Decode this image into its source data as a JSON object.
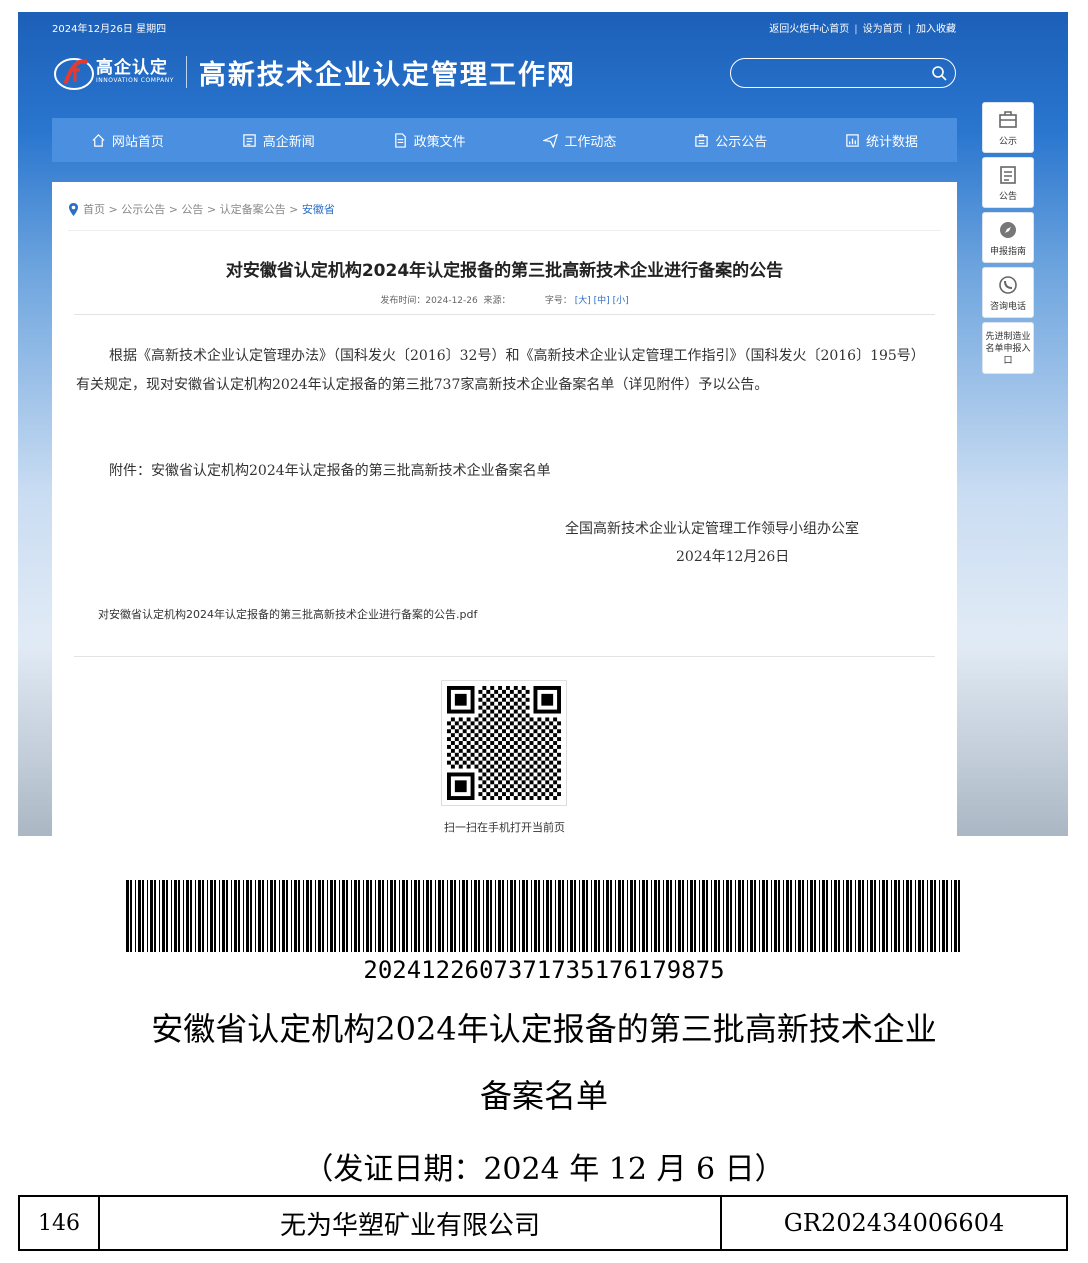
{
  "topbar": {
    "date": "2024年12月26日 星期四",
    "links": [
      "返回火炬中心首页",
      "设为首页",
      "加入收藏"
    ]
  },
  "logo": {
    "cn": "高企认定",
    "en": "INNOVATION COMPANY"
  },
  "site_title": "高新技术企业认定管理工作网",
  "search": {
    "value": ""
  },
  "nav": [
    {
      "label": "网站首页",
      "icon": "home-icon"
    },
    {
      "label": "高企新闻",
      "icon": "news-icon"
    },
    {
      "label": "政策文件",
      "icon": "document-icon"
    },
    {
      "label": "工作动态",
      "icon": "send-icon"
    },
    {
      "label": "公示公告",
      "icon": "announcement-icon"
    },
    {
      "label": "统计数据",
      "icon": "chart-icon"
    }
  ],
  "side": [
    {
      "label": "公示",
      "icon": "briefcase-icon"
    },
    {
      "label": "公告",
      "icon": "clipboard-icon"
    },
    {
      "label": "申报指南",
      "icon": "compass-icon"
    },
    {
      "label": "咨询电话",
      "icon": "phone-icon"
    },
    {
      "label": "先进制造业名单申报入口"
    }
  ],
  "breadcrumb": {
    "items": [
      "首页",
      "公示公告",
      "公告",
      "认定备案公告"
    ],
    "current": "安徽省",
    "sep": ">"
  },
  "article": {
    "title": "对安徽省认定机构2024年认定报备的第三批高新技术企业进行备案的公告",
    "meta_time_label": "发布时间：",
    "meta_time": "2024-12-26",
    "meta_source_label": "来源：",
    "meta_fontsize_label": "字号：",
    "font_sizes": [
      "[大]",
      "[中]",
      "[小]"
    ],
    "body": "根据《高新技术企业认定管理办法》（国科发火〔2016〕32号）和《高新技术企业认定管理工作指引》（国科发火〔2016〕195号）有关规定，现对安徽省认定机构2024年认定报备的第三批737家高新技术企业备案名单（详见附件）予以公告。",
    "attachment": "附件：安徽省认定机构2024年认定报备的第三批高新技术企业备案名单",
    "signer": "全国高新技术企业认定管理工作领导小组办公室",
    "sign_date": "2024年12月26日",
    "pdf_link": "对安徽省认定机构2024年认定报备的第三批高新技术企业进行备案的公告.pdf",
    "qr_caption": "扫一扫在手机打开当前页"
  },
  "pdf_page": {
    "barcode_number": "20241226073717351761798­75",
    "title_line1": "安徽省认定机构2024年认定报备的第三批高新技术企业",
    "title_line2": "备案名单",
    "issue_date": "（发证日期：2024 年 12 月 6 日）",
    "table_row": {
      "no": "146",
      "company": "无为华塑矿业有限公司",
      "cert": "GR202434006604"
    }
  }
}
